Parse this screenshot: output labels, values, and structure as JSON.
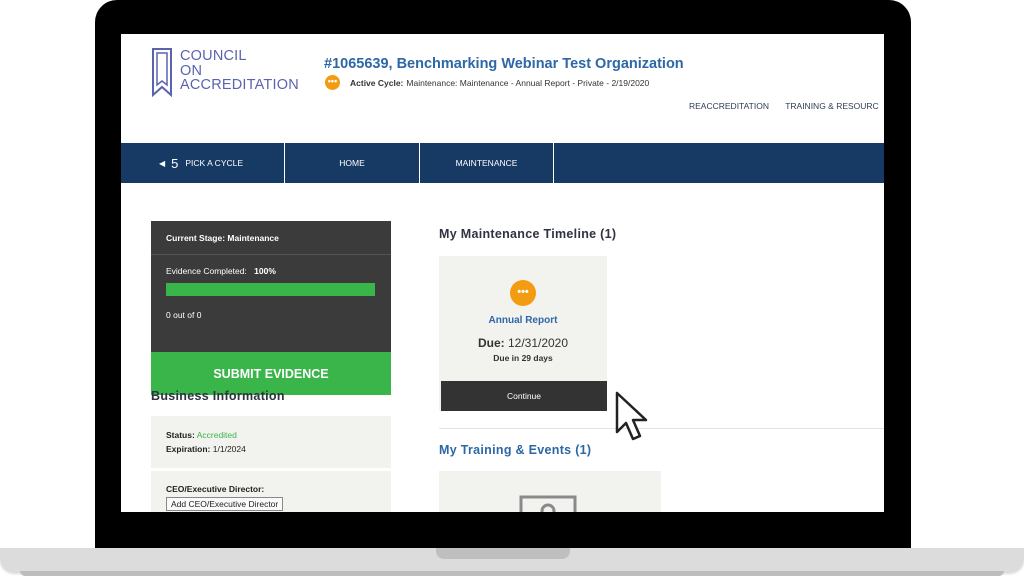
{
  "header": {
    "logo_lines": [
      "COUNCIL",
      "ON",
      "ACCREDITATION"
    ],
    "org_title": "#1065639, Benchmarking Webinar Test Organization",
    "cycle_icon": "•••",
    "cycle_label": "Active Cycle:",
    "cycle_value": "Maintenance: Maintenance - Annual Report - Private - 2/19/2020",
    "top_links": [
      "REACCREDITATION",
      "TRAINING & RESOURC"
    ]
  },
  "navbar": {
    "pick_number": "5",
    "pick_label": "PICK A CYCLE",
    "home_label": "HOME",
    "maintenance_label": "MAINTENANCE"
  },
  "stage": {
    "current_stage": "Current Stage: Maintenance",
    "evidence_label": "Evidence Completed:",
    "evidence_percent": "100%",
    "evidence_progress": 1.0,
    "count_text": "0 out of 0",
    "submit_label": "SUBMIT EVIDENCE"
  },
  "business": {
    "title": "Business Information",
    "status_label": "Status:",
    "status_value": "Accredited",
    "expiration_label": "Expiration:",
    "expiration_value": "1/1/2024",
    "ceo_label": "CEO/Executive Director:",
    "ceo_button": "Add CEO/Executive Director"
  },
  "timeline": {
    "title": "My Maintenance Timeline (1)",
    "card_icon": "•••",
    "card_name": "Annual Report",
    "due_label": "Due:",
    "due_date": "12/31/2020",
    "due_in": "Due in 29 days",
    "continue_label": "Continue"
  },
  "training": {
    "title": "My Training & Events (1)"
  },
  "colors": {
    "brand_blue": "#2d67a6",
    "nav_blue": "#173a64",
    "green": "#39b54a",
    "orange": "#f39c12",
    "dark_panel": "#3b3b3b"
  }
}
